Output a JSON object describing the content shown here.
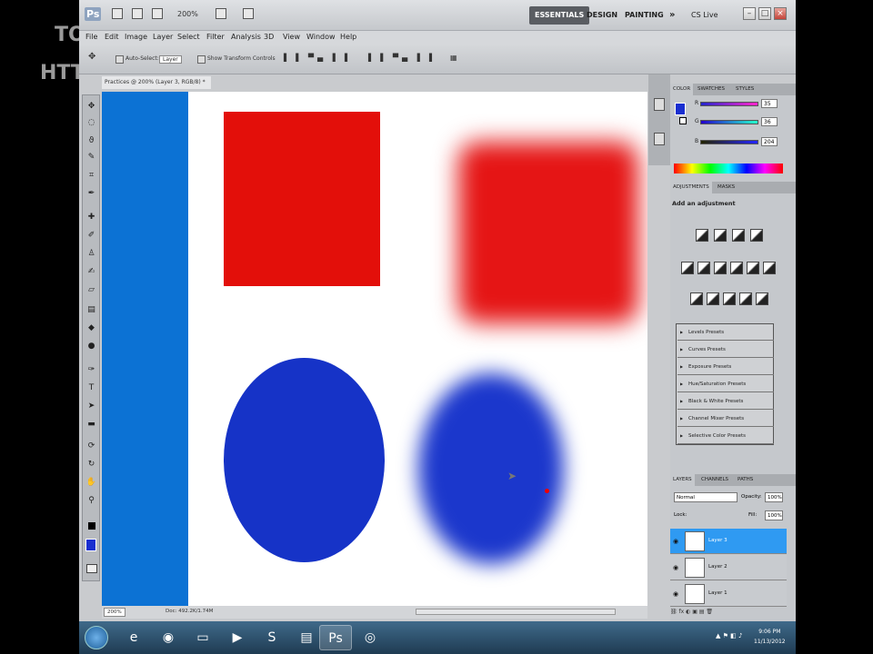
{
  "watermark": {
    "line1": "TO",
    "line2": "HTT"
  },
  "titlebar": {
    "logo": "Ps",
    "zoom": "200%",
    "workspaces": [
      "ESSENTIALS",
      "DESIGN",
      "PAINTING",
      "»"
    ],
    "cslive": "CS Live"
  },
  "menu": [
    "File",
    "Edit",
    "Image",
    "Layer",
    "Select",
    "Filter",
    "Analysis",
    "3D",
    "View",
    "Window",
    "Help"
  ],
  "options": {
    "auto_select": "Auto-Select:",
    "auto_select_value": "Layer",
    "transform": "Show Transform Controls"
  },
  "document": {
    "tab_title": "Practices @ 200% (Layer 3, RGB/8) *",
    "zoom": "200%",
    "doc_size": "Doc: 492.2K/1.74M"
  },
  "panels": {
    "color_tabs": [
      "COLOR",
      "SWATCHES",
      "STYLES"
    ],
    "color": {
      "labels": [
        "R",
        "G",
        "B"
      ],
      "values": [
        "35",
        "36",
        "204"
      ],
      "foreground": "#1a2fd0"
    },
    "adjustment_tabs": [
      "ADJUSTMENTS",
      "MASKS"
    ],
    "adjustment_heading": "Add an adjustment",
    "presets": [
      "Levels Presets",
      "Curves Presets",
      "Exposure Presets",
      "Hue/Saturation Presets",
      "Black & White Presets",
      "Channel Mixer Presets",
      "Selective Color Presets"
    ],
    "layer_tabs": [
      "LAYERS",
      "CHANNELS",
      "PATHS"
    ],
    "blend_mode": "Normal",
    "opacity_label": "Opacity:",
    "opacity": "100%",
    "lock_label": "Lock:",
    "fill_label": "Fill:",
    "fill": "100%",
    "layers": [
      {
        "name": "Layer 3",
        "selected": true
      },
      {
        "name": "Layer 2",
        "selected": false
      },
      {
        "name": "Layer 1",
        "selected": false
      }
    ]
  },
  "taskbar": {
    "time": "9:06 PM",
    "date": "11/13/2012"
  },
  "colors": {
    "accent": "#2f9af2",
    "canvas_red": "#e30f0a",
    "canvas_blue": "#1633c7",
    "strip_blue": "#0c72d4"
  }
}
